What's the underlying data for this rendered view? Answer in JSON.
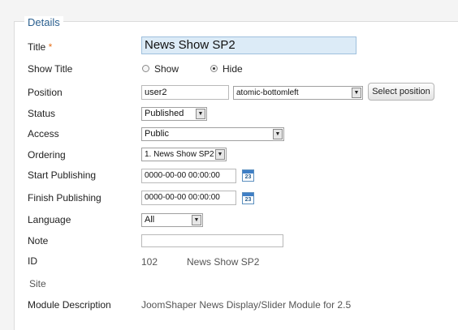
{
  "section": {
    "legend": "Details"
  },
  "fields": {
    "title": {
      "label": "Title",
      "required_mark": "*",
      "value": "News Show SP2"
    },
    "show_title": {
      "label": "Show Title",
      "options": [
        "Show",
        "Hide"
      ],
      "selected": "Hide"
    },
    "position": {
      "label": "Position",
      "value": "user2",
      "select_value": "atomic-bottomleft",
      "button_label": "Select position"
    },
    "status": {
      "label": "Status",
      "value": "Published"
    },
    "access": {
      "label": "Access",
      "value": "Public"
    },
    "ordering": {
      "label": "Ordering",
      "value": "1. News Show SP2"
    },
    "start_publishing": {
      "label": "Start Publishing",
      "value": "0000-00-00 00:00:00"
    },
    "finish_publishing": {
      "label": "Finish Publishing",
      "value": "0000-00-00 00:00:00"
    },
    "language": {
      "label": "Language",
      "value": "All"
    },
    "note": {
      "label": "Note",
      "value": ""
    },
    "id": {
      "label": "ID",
      "value": "102",
      "name": "News Show SP2"
    },
    "site": {
      "label": "Site"
    },
    "module_description": {
      "label": "Module Description",
      "value": "JoomShaper News Display/Slider Module for 2.5"
    }
  },
  "calendar_icon_text": "23",
  "icons": {
    "calendar": "calendar-icon",
    "dropdown": "chevron-down-icon",
    "radio": "radio-icon"
  },
  "colors": {
    "legend": "#2a5f8f",
    "title_field_bg": "#dcebf7",
    "required": "#e5701a"
  }
}
